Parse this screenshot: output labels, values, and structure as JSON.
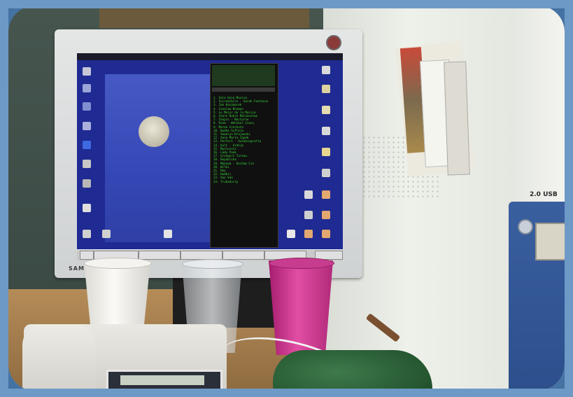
{
  "scene": {
    "type": "photograph",
    "colors": {
      "border": "#6d99c6",
      "screen_desktop": "#1f2a92",
      "playlist_text": "#39d63a",
      "pink_cup": "#e24ea3",
      "mouse_pad": "#2f6a3c"
    }
  },
  "monitor": {
    "brand": "SAMSUNG"
  },
  "computer_tower": {
    "label": "2.0 USB"
  },
  "desktop": {
    "playlist": [
      "1. Sala Quia Musica",
      "2. Incredibile - Sarah Fontaine",
      "3. Jan Kaczmarek",
      "4. Czeslaw Niemen",
      "5. Lo Mejor de la Musica",
      "6. Stare Dobre Malzenstwo",
      "7. Chopin - Nocturne",
      "8. Dzem - Wehikul Czasu",
      "9. Marek Grechuta",
      "10. Budka Suflera",
      "11. Seweryn Krajewski",
      "12. Anna Maria Jopek",
      "13. Perfect - Autobiografia",
      "14. Kult - Arahja",
      "15. Myslovitz",
      "16. Lady Pank",
      "17. Grzegorz Turnau",
      "18. Republika",
      "19. Maanam - Kocham Cie",
      "20. Wilki",
      "21. Hey",
      "22. Kombii",
      "23. Voo Voo",
      "24. Trubadurzy"
    ]
  }
}
